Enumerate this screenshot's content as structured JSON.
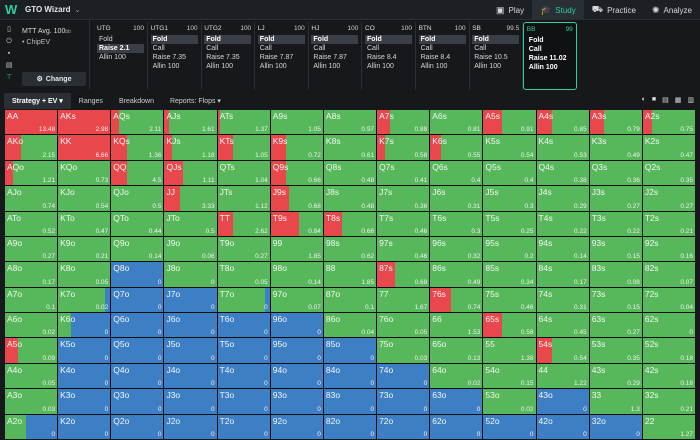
{
  "app": {
    "title": "GTO Wizard",
    "logo_letter": "W"
  },
  "nav": [
    {
      "label": "Play",
      "icon": "▣",
      "active": false
    },
    {
      "label": "Study",
      "icon": "🎓",
      "active": true
    },
    {
      "label": "Practice",
      "icon": "⛟",
      "active": false
    },
    {
      "label": "Analyze",
      "icon": "✺",
      "active": false
    }
  ],
  "game": {
    "format": "MTT",
    "depth": "Avg. 100",
    "depth_unit": "bb",
    "model": "ChipEV",
    "change_label": "Change"
  },
  "positions": [
    {
      "name": "UTG",
      "stack": "100",
      "actions": [
        "Fold",
        "Raise 2.1",
        "Allin 100"
      ],
      "selected": 1
    },
    {
      "name": "UTG1",
      "stack": "100",
      "actions": [
        "Fold",
        "Call",
        "Raise 7.35",
        "Allin 100"
      ],
      "selected": 0
    },
    {
      "name": "UTG2",
      "stack": "100",
      "actions": [
        "Fold",
        "Call",
        "Raise 7.35",
        "Allin 100"
      ],
      "selected": 0
    },
    {
      "name": "LJ",
      "stack": "100",
      "actions": [
        "Fold",
        "Call",
        "Raise 7.87",
        "Allin 100"
      ],
      "selected": 0
    },
    {
      "name": "HJ",
      "stack": "100",
      "actions": [
        "Fold",
        "Call",
        "Raise 7.87",
        "Allin 100"
      ],
      "selected": 0
    },
    {
      "name": "CO",
      "stack": "100",
      "actions": [
        "Fold",
        "Call",
        "Raise 8.4",
        "Allin 100"
      ],
      "selected": 0
    },
    {
      "name": "BTN",
      "stack": "100",
      "actions": [
        "Fold",
        "Call",
        "Raise 8.4",
        "Allin 100"
      ],
      "selected": 0
    },
    {
      "name": "SB",
      "stack": "99.5",
      "actions": [
        "Fold",
        "Call",
        "Raise 10.5",
        "Allin 100"
      ],
      "selected": 0
    },
    {
      "name": "BB",
      "stack": "99",
      "actions": [
        "Fold",
        "Call",
        "Raise 11.02",
        "Allin 100"
      ],
      "selected": -1,
      "current": true
    }
  ],
  "toolbar": {
    "tabs": [
      "Strategy + EV ▾",
      "Ranges",
      "Breakdown",
      "Reports: Flops ▾"
    ],
    "active": 0
  },
  "colors": {
    "raise": "#e8474b",
    "call": "#57b85b",
    "fold": "#3d7fc4"
  },
  "grid": [
    [
      {
        "h": "AA",
        "ev": "13.48",
        "f": 0,
        "r": 1
      },
      {
        "h": "AKs",
        "ev": "2.98",
        "f": 0,
        "r": 1
      },
      {
        "h": "AQs",
        "ev": "2.11",
        "f": 0,
        "r": 0.15
      },
      {
        "h": "AJs",
        "ev": "1.61",
        "f": 0,
        "r": 0.08
      },
      {
        "h": "ATs",
        "ev": "1.37",
        "f": 0,
        "r": 0.05
      },
      {
        "h": "A9s",
        "ev": "1.05",
        "f": 0,
        "r": 0
      },
      {
        "h": "A8s",
        "ev": "0.97",
        "f": 0,
        "r": 0
      },
      {
        "h": "A7s",
        "ev": "0.88",
        "f": 0,
        "r": 0.25
      },
      {
        "h": "A6s",
        "ev": "0.81",
        "f": 0,
        "r": 0
      },
      {
        "h": "A5s",
        "ev": "0.91",
        "f": 0,
        "r": 0.35
      },
      {
        "h": "A4s",
        "ev": "0.85",
        "f": 0,
        "r": 0.3
      },
      {
        "h": "A3s",
        "ev": "0.79",
        "f": 0,
        "r": 0.28
      },
      {
        "h": "A2s",
        "ev": "0.75",
        "f": 0,
        "r": 0.18
      }
    ],
    [
      {
        "h": "AKo",
        "ev": "2.15",
        "f": 0,
        "r": 0.3
      },
      {
        "h": "KK",
        "ev": "6.66",
        "f": 0,
        "r": 1
      },
      {
        "h": "KQs",
        "ev": "1.36",
        "f": 0,
        "r": 0.3
      },
      {
        "h": "KJs",
        "ev": "1.18",
        "f": 0,
        "r": 0.15
      },
      {
        "h": "KTs",
        "ev": "1.05",
        "f": 0,
        "r": 0.3
      },
      {
        "h": "K9s",
        "ev": "0.72",
        "f": 0,
        "r": 0.3
      },
      {
        "h": "K8s",
        "ev": "0.61",
        "f": 0,
        "r": 0
      },
      {
        "h": "K7s",
        "ev": "0.58",
        "f": 0,
        "r": 0.15
      },
      {
        "h": "K6s",
        "ev": "0.55",
        "f": 0,
        "r": 0.2
      },
      {
        "h": "K5s",
        "ev": "0.54",
        "f": 0,
        "r": 0
      },
      {
        "h": "K4s",
        "ev": "0.53",
        "f": 0,
        "r": 0
      },
      {
        "h": "K3s",
        "ev": "0.49",
        "f": 0,
        "r": 0
      },
      {
        "h": "K2s",
        "ev": "0.47",
        "f": 0,
        "r": 0
      }
    ],
    [
      {
        "h": "AQo",
        "ev": "1.21",
        "f": 0,
        "r": 0.15
      },
      {
        "h": "KQo",
        "ev": "0.73",
        "f": 0,
        "r": 0
      },
      {
        "h": "QQ",
        "ev": "4.5",
        "f": 0,
        "r": 0.3
      },
      {
        "h": "QJs",
        "ev": "1.11",
        "f": 0,
        "r": 0.35
      },
      {
        "h": "QTs",
        "ev": "1.04",
        "f": 0,
        "r": 0
      },
      {
        "h": "Q9s",
        "ev": "0.66",
        "f": 0,
        "r": 0.3
      },
      {
        "h": "Q8s",
        "ev": "0.48",
        "f": 0,
        "r": 0
      },
      {
        "h": "Q7s",
        "ev": "0.41",
        "f": 0,
        "r": 0
      },
      {
        "h": "Q6s",
        "ev": "0.4",
        "f": 0,
        "r": 0
      },
      {
        "h": "Q5s",
        "ev": "0.4",
        "f": 0,
        "r": 0
      },
      {
        "h": "Q4s",
        "ev": "0.38",
        "f": 0,
        "r": 0
      },
      {
        "h": "Q3s",
        "ev": "0.36",
        "f": 0,
        "r": 0
      },
      {
        "h": "Q2s",
        "ev": "0.35",
        "f": 0,
        "r": 0
      }
    ],
    [
      {
        "h": "AJo",
        "ev": "0.74",
        "f": 0,
        "r": 0
      },
      {
        "h": "KJo",
        "ev": "0.54",
        "f": 0,
        "r": 0
      },
      {
        "h": "QJo",
        "ev": "0.5",
        "f": 0,
        "r": 0
      },
      {
        "h": "JJ",
        "ev": "3.33",
        "f": 0,
        "r": 0.3
      },
      {
        "h": "JTs",
        "ev": "1.12",
        "f": 0,
        "r": 0
      },
      {
        "h": "J9s",
        "ev": "0.68",
        "f": 0,
        "r": 0.35
      },
      {
        "h": "J8s",
        "ev": "0.48",
        "f": 0,
        "r": 0
      },
      {
        "h": "J7s",
        "ev": "0.36",
        "f": 0,
        "r": 0
      },
      {
        "h": "J6s",
        "ev": "0.31",
        "f": 0,
        "r": 0
      },
      {
        "h": "J5s",
        "ev": "0.3",
        "f": 0,
        "r": 0
      },
      {
        "h": "J4s",
        "ev": "0.29",
        "f": 0,
        "r": 0
      },
      {
        "h": "J3s",
        "ev": "0.27",
        "f": 0,
        "r": 0
      },
      {
        "h": "J2s",
        "ev": "0.27",
        "f": 0,
        "r": 0
      }
    ],
    [
      {
        "h": "ATo",
        "ev": "0.52",
        "f": 0,
        "r": 0
      },
      {
        "h": "KTo",
        "ev": "0.47",
        "f": 0,
        "r": 0
      },
      {
        "h": "QTo",
        "ev": "0.44",
        "f": 0,
        "r": 0
      },
      {
        "h": "JTo",
        "ev": "0.5",
        "f": 0,
        "r": 0
      },
      {
        "h": "TT",
        "ev": "2.62",
        "f": 0,
        "r": 0.3
      },
      {
        "h": "T9s",
        "ev": "0.84",
        "f": 0,
        "r": 0.55
      },
      {
        "h": "T8s",
        "ev": "0.66",
        "f": 0,
        "r": 0.35
      },
      {
        "h": "T7s",
        "ev": "0.46",
        "f": 0,
        "r": 0
      },
      {
        "h": "T6s",
        "ev": "0.3",
        "f": 0,
        "r": 0
      },
      {
        "h": "T5s",
        "ev": "0.25",
        "f": 0,
        "r": 0
      },
      {
        "h": "T4s",
        "ev": "0.22",
        "f": 0,
        "r": 0
      },
      {
        "h": "T3s",
        "ev": "0.22",
        "f": 0,
        "r": 0
      },
      {
        "h": "T2s",
        "ev": "0.21",
        "f": 0,
        "r": 0
      }
    ],
    [
      {
        "h": "A9o",
        "ev": "0.27",
        "f": 0,
        "r": 0
      },
      {
        "h": "K9o",
        "ev": "0.21",
        "f": 0,
        "r": 0
      },
      {
        "h": "Q9o",
        "ev": "0.14",
        "f": 0,
        "r": 0
      },
      {
        "h": "J9o",
        "ev": "0.06",
        "f": 0,
        "r": 0
      },
      {
        "h": "T9o",
        "ev": "0.27",
        "f": 0,
        "r": 0
      },
      {
        "h": "99",
        "ev": "1.85",
        "f": 0,
        "r": 0
      },
      {
        "h": "98s",
        "ev": "0.62",
        "f": 0,
        "r": 0
      },
      {
        "h": "97s",
        "ev": "0.46",
        "f": 0,
        "r": 0
      },
      {
        "h": "96s",
        "ev": "0.32",
        "f": 0,
        "r": 0
      },
      {
        "h": "95s",
        "ev": "0.2",
        "f": 0,
        "r": 0
      },
      {
        "h": "94s",
        "ev": "0.14",
        "f": 0,
        "r": 0
      },
      {
        "h": "93s",
        "ev": "0.15",
        "f": 0,
        "r": 0
      },
      {
        "h": "92s",
        "ev": "0.16",
        "f": 0,
        "r": 0
      }
    ],
    [
      {
        "h": "A8o",
        "ev": "0.17",
        "f": 0,
        "r": 0
      },
      {
        "h": "K8o",
        "ev": "0.05",
        "f": 0,
        "r": 0
      },
      {
        "h": "Q8o",
        "ev": "0",
        "f": 1,
        "r": 0
      },
      {
        "h": "J8o",
        "ev": "0",
        "f": 0,
        "r": 0
      },
      {
        "h": "T8o",
        "ev": "0.05",
        "f": 0,
        "r": 0
      },
      {
        "h": "98o",
        "ev": "0.14",
        "f": 0,
        "r": 0
      },
      {
        "h": "88",
        "ev": "1.85",
        "f": 0,
        "r": 0
      },
      {
        "h": "87s",
        "ev": "0.68",
        "f": 0,
        "r": 0.35
      },
      {
        "h": "86s",
        "ev": "0.49",
        "f": 0,
        "r": 0
      },
      {
        "h": "85s",
        "ev": "0.34",
        "f": 0,
        "r": 0
      },
      {
        "h": "84s",
        "ev": "0.17",
        "f": 0,
        "r": 0
      },
      {
        "h": "83s",
        "ev": "0.08",
        "f": 0,
        "r": 0
      },
      {
        "h": "82s",
        "ev": "0.07",
        "f": 0,
        "r": 0
      }
    ],
    [
      {
        "h": "A7o",
        "ev": "0.1",
        "f": 0,
        "r": 0
      },
      {
        "h": "K7o",
        "ev": "0.02",
        "f": 0.1,
        "r": 0
      },
      {
        "h": "Q7o",
        "ev": "0",
        "f": 1,
        "r": 0
      },
      {
        "h": "J7o",
        "ev": "0",
        "f": 1,
        "r": 0
      },
      {
        "h": "T7o",
        "ev": "0",
        "f": 0.1,
        "r": 0
      },
      {
        "h": "97o",
        "ev": "0.07",
        "f": 0,
        "r": 0
      },
      {
        "h": "87o",
        "ev": "0.1",
        "f": 0,
        "r": 0
      },
      {
        "h": "77",
        "ev": "1.67",
        "f": 0,
        "r": 0
      },
      {
        "h": "76s",
        "ev": "0.74",
        "f": 0,
        "r": 0.4
      },
      {
        "h": "75s",
        "ev": "0.46",
        "f": 0,
        "r": 0
      },
      {
        "h": "74s",
        "ev": "0.31",
        "f": 0,
        "r": 0
      },
      {
        "h": "73s",
        "ev": "0.15",
        "f": 0,
        "r": 0
      },
      {
        "h": "72s",
        "ev": "0.04",
        "f": 0,
        "r": 0
      }
    ],
    [
      {
        "h": "A6o",
        "ev": "0.02",
        "f": 0,
        "r": 0
      },
      {
        "h": "K6o",
        "ev": "0",
        "f": 0.75,
        "r": 0
      },
      {
        "h": "Q6o",
        "ev": "0",
        "f": 1,
        "r": 0
      },
      {
        "h": "J6o",
        "ev": "0",
        "f": 1,
        "r": 0
      },
      {
        "h": "T6o",
        "ev": "0",
        "f": 1,
        "r": 0
      },
      {
        "h": "96o",
        "ev": "0",
        "f": 1,
        "r": 0
      },
      {
        "h": "86o",
        "ev": "0.04",
        "f": 0,
        "r": 0
      },
      {
        "h": "76o",
        "ev": "0.05",
        "f": 0,
        "r": 0
      },
      {
        "h": "66",
        "ev": "1.53",
        "f": 0,
        "r": 0
      },
      {
        "h": "65s",
        "ev": "0.58",
        "f": 0,
        "r": 0.35
      },
      {
        "h": "64s",
        "ev": "0.45",
        "f": 0,
        "r": 0
      },
      {
        "h": "63s",
        "ev": "0.27",
        "f": 0,
        "r": 0
      },
      {
        "h": "62s",
        "ev": "0",
        "f": 0,
        "r": 0
      }
    ],
    [
      {
        "h": "A5o",
        "ev": "0.09",
        "f": 0,
        "r": 0.25
      },
      {
        "h": "K5o",
        "ev": "0",
        "f": 1,
        "r": 0
      },
      {
        "h": "Q5o",
        "ev": "0",
        "f": 1,
        "r": 0
      },
      {
        "h": "J5o",
        "ev": "0",
        "f": 1,
        "r": 0
      },
      {
        "h": "T5o",
        "ev": "0",
        "f": 1,
        "r": 0
      },
      {
        "h": "95o",
        "ev": "0",
        "f": 1,
        "r": 0
      },
      {
        "h": "85o",
        "ev": "0",
        "f": 1,
        "r": 0
      },
      {
        "h": "75o",
        "ev": "0.03",
        "f": 0,
        "r": 0
      },
      {
        "h": "65o",
        "ev": "0.13",
        "f": 0,
        "r": 0
      },
      {
        "h": "55",
        "ev": "1.38",
        "f": 0,
        "r": 0
      },
      {
        "h": "54s",
        "ev": "0.54",
        "f": 0,
        "r": 0.3
      },
      {
        "h": "53s",
        "ev": "0.35",
        "f": 0,
        "r": 0
      },
      {
        "h": "52s",
        "ev": "0.18",
        "f": 0,
        "r": 0
      }
    ],
    [
      {
        "h": "A4o",
        "ev": "0.05",
        "f": 0,
        "r": 0
      },
      {
        "h": "K4o",
        "ev": "0",
        "f": 1,
        "r": 0
      },
      {
        "h": "Q4o",
        "ev": "0",
        "f": 1,
        "r": 0
      },
      {
        "h": "J4o",
        "ev": "0",
        "f": 1,
        "r": 0
      },
      {
        "h": "T4o",
        "ev": "0",
        "f": 1,
        "r": 0
      },
      {
        "h": "94o",
        "ev": "0",
        "f": 1,
        "r": 0
      },
      {
        "h": "84o",
        "ev": "0",
        "f": 1,
        "r": 0
      },
      {
        "h": "74o",
        "ev": "0",
        "f": 1,
        "r": 0
      },
      {
        "h": "64o",
        "ev": "0.02",
        "f": 0,
        "r": 0
      },
      {
        "h": "54o",
        "ev": "0.15",
        "f": 0,
        "r": 0
      },
      {
        "h": "44",
        "ev": "1.22",
        "f": 0,
        "r": 0
      },
      {
        "h": "43s",
        "ev": "0.29",
        "f": 0,
        "r": 0
      },
      {
        "h": "42s",
        "ev": "0.18",
        "f": 0,
        "r": 0
      }
    ],
    [
      {
        "h": "A3o",
        "ev": "0.03",
        "f": 0,
        "r": 0
      },
      {
        "h": "K3o",
        "ev": "0",
        "f": 1,
        "r": 0
      },
      {
        "h": "Q3o",
        "ev": "0",
        "f": 1,
        "r": 0
      },
      {
        "h": "J3o",
        "ev": "0",
        "f": 1,
        "r": 0
      },
      {
        "h": "T3o",
        "ev": "0",
        "f": 1,
        "r": 0
      },
      {
        "h": "93o",
        "ev": "0",
        "f": 1,
        "r": 0
      },
      {
        "h": "83o",
        "ev": "0",
        "f": 1,
        "r": 0
      },
      {
        "h": "73o",
        "ev": "0",
        "f": 1,
        "r": 0
      },
      {
        "h": "63o",
        "ev": "0",
        "f": 1,
        "r": 0
      },
      {
        "h": "53o",
        "ev": "0.02",
        "f": 0,
        "r": 0
      },
      {
        "h": "43o",
        "ev": "0",
        "f": 1,
        "r": 0
      },
      {
        "h": "33",
        "ev": "1.3",
        "f": 0,
        "r": 0
      },
      {
        "h": "32s",
        "ev": "0.21",
        "f": 0,
        "r": 0
      }
    ],
    [
      {
        "h": "A2o",
        "ev": "0",
        "f": 0.6,
        "r": 0
      },
      {
        "h": "K2o",
        "ev": "0",
        "f": 1,
        "r": 0
      },
      {
        "h": "Q2o",
        "ev": "0",
        "f": 1,
        "r": 0
      },
      {
        "h": "J2o",
        "ev": "0",
        "f": 1,
        "r": 0
      },
      {
        "h": "T2o",
        "ev": "0",
        "f": 1,
        "r": 0
      },
      {
        "h": "92o",
        "ev": "0",
        "f": 1,
        "r": 0
      },
      {
        "h": "82o",
        "ev": "0",
        "f": 1,
        "r": 0
      },
      {
        "h": "72o",
        "ev": "0",
        "f": 1,
        "r": 0
      },
      {
        "h": "62o",
        "ev": "0",
        "f": 1,
        "r": 0
      },
      {
        "h": "52o",
        "ev": "0",
        "f": 1,
        "r": 0
      },
      {
        "h": "42o",
        "ev": "0",
        "f": 1,
        "r": 0
      },
      {
        "h": "32o",
        "ev": "0",
        "f": 1,
        "r": 0
      },
      {
        "h": "22",
        "ev": "1.27",
        "f": 0,
        "r": 0
      }
    ]
  ]
}
